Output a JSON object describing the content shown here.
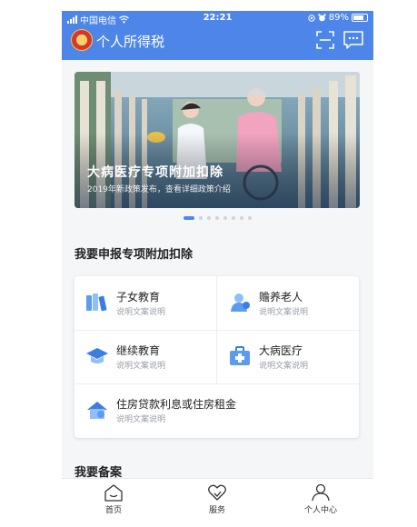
{
  "status_bar": {
    "carrier": "中国电信",
    "time": "22:21",
    "battery": "89%"
  },
  "header": {
    "title": "个人所得税"
  },
  "banner": {
    "title": "大病医疗专项附加扣除",
    "subtitle": "2019年新政策发布，查看详细政策介绍"
  },
  "carousel": {
    "total": 8,
    "active_index": 0
  },
  "section_declare": {
    "title": "我要申报专项附加扣除",
    "items": [
      {
        "label": "子女教育",
        "desc": "说明文案说明",
        "icon": "books-icon"
      },
      {
        "label": "赡养老人",
        "desc": "说明文案说明",
        "icon": "elder-icon"
      },
      {
        "label": "继续教育",
        "desc": "说明文案说明",
        "icon": "graduation-cap-icon"
      },
      {
        "label": "大病医疗",
        "desc": "说明文案说明",
        "icon": "medical-kit-icon"
      },
      {
        "label": "住房贷款利息或住房租金",
        "desc": "说明文案说明",
        "icon": "house-icon"
      }
    ]
  },
  "section_record": {
    "title": "我要备案"
  },
  "tabbar": {
    "tabs": [
      {
        "label": "首页"
      },
      {
        "label": "服务"
      },
      {
        "label": "个人中心"
      }
    ]
  },
  "colors": {
    "primary": "#4d86e8",
    "text": "#222222",
    "muted": "#9a9ea6"
  }
}
